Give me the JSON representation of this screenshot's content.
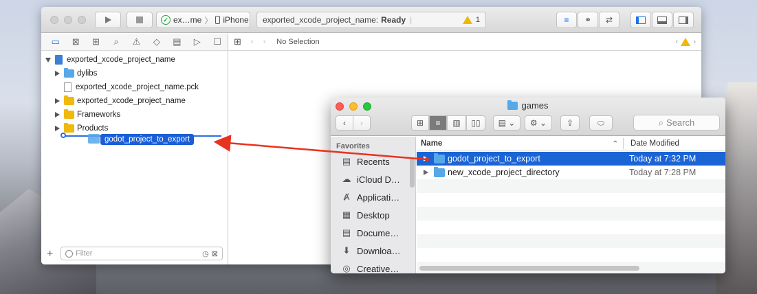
{
  "xcode": {
    "scheme": {
      "target": "ex…me",
      "device": "iPhone"
    },
    "status": {
      "project": "exported_xcode_project_name",
      "state": "Ready",
      "warnings": "1"
    },
    "jump_bar": "No Selection",
    "tree": {
      "root": "exported_xcode_project_name",
      "items": [
        {
          "label": "dylibs",
          "kind": "folder-blue"
        },
        {
          "label": "exported_xcode_project_name.pck",
          "kind": "file"
        },
        {
          "label": "exported_xcode_project_name",
          "kind": "folder-yellow"
        },
        {
          "label": "Frameworks",
          "kind": "folder-yellow"
        },
        {
          "label": "Products",
          "kind": "folder-yellow"
        }
      ]
    },
    "drag_label": "godot_project_to_export",
    "filter_placeholder": "Filter"
  },
  "finder": {
    "title": "games",
    "search_placeholder": "Search",
    "sidebar": {
      "heading": "Favorites",
      "items": [
        {
          "label": "Recents",
          "icon": "recents-icon"
        },
        {
          "label": "iCloud D…",
          "icon": "cloud-icon"
        },
        {
          "label": "Applicati…",
          "icon": "applications-icon"
        },
        {
          "label": "Desktop",
          "icon": "desktop-icon"
        },
        {
          "label": "Docume…",
          "icon": "documents-icon"
        },
        {
          "label": "Downloa…",
          "icon": "downloads-icon"
        },
        {
          "label": "Creative…",
          "icon": "creative-cloud-icon"
        }
      ]
    },
    "columns": {
      "name": "Name",
      "date": "Date Modified"
    },
    "rows": [
      {
        "name": "godot_project_to_export",
        "date": "Today at 7:32 PM",
        "selected": true
      },
      {
        "name": "new_xcode_project_directory",
        "date": "Today at 7:28 PM",
        "selected": false
      }
    ]
  },
  "colors": {
    "selection": "#1a64d6",
    "arrow": "#e8331f",
    "folder_blue": "#56a8e8",
    "folder_yellow": "#f0b90c"
  }
}
